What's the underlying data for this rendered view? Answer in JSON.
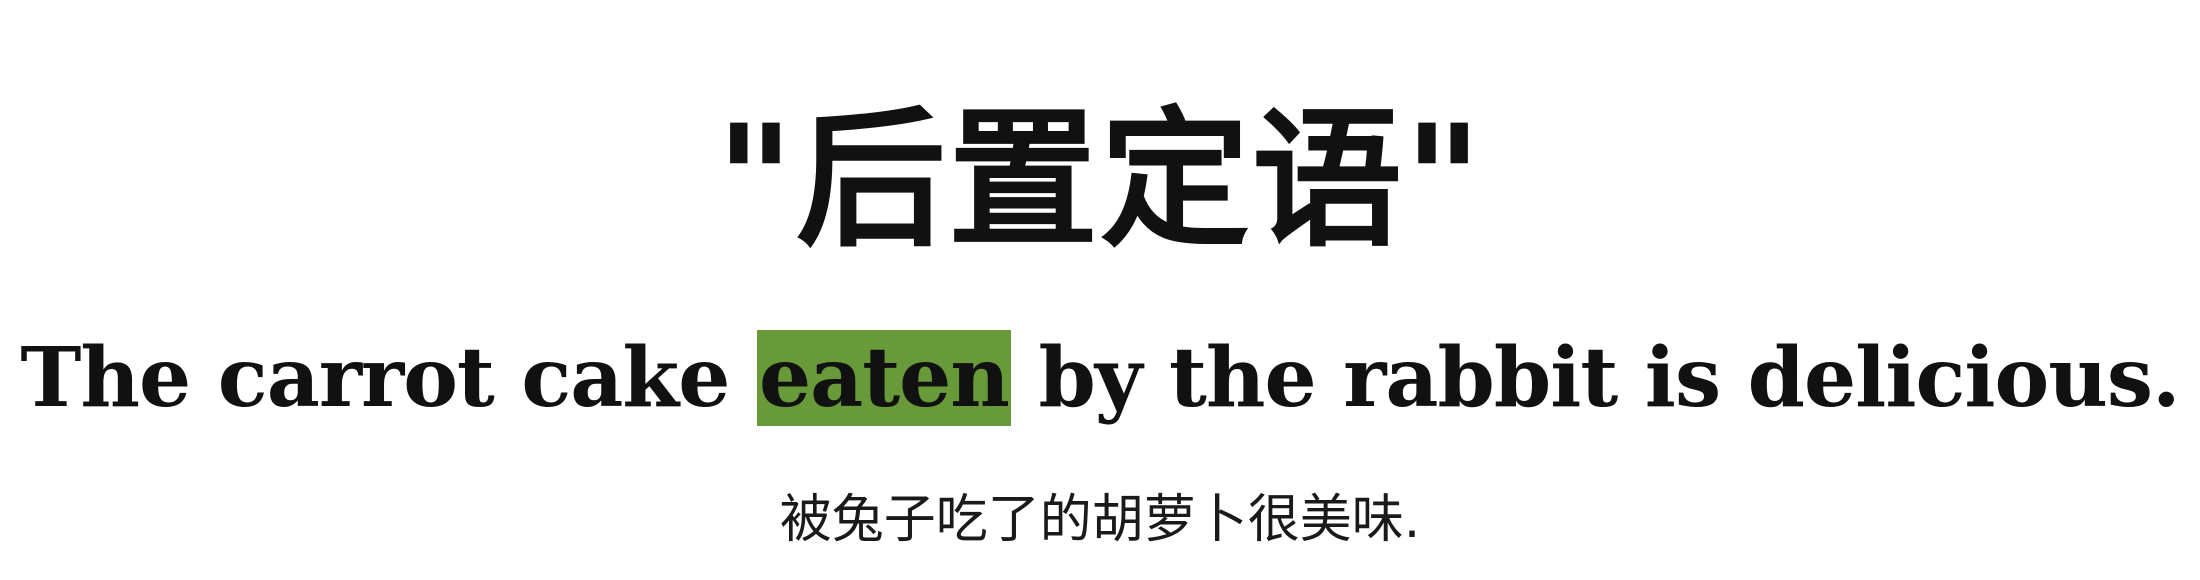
{
  "title": {
    "quote_open": "\"",
    "text": "后置定语",
    "quote_close": "\""
  },
  "sentence": {
    "before": "The carrot cake ",
    "highlight": "eaten",
    "after": " by the rabbit is delicious.",
    "highlight_color": "#689a39"
  },
  "translation": "被兔子吃了的胡萝卜很美味."
}
